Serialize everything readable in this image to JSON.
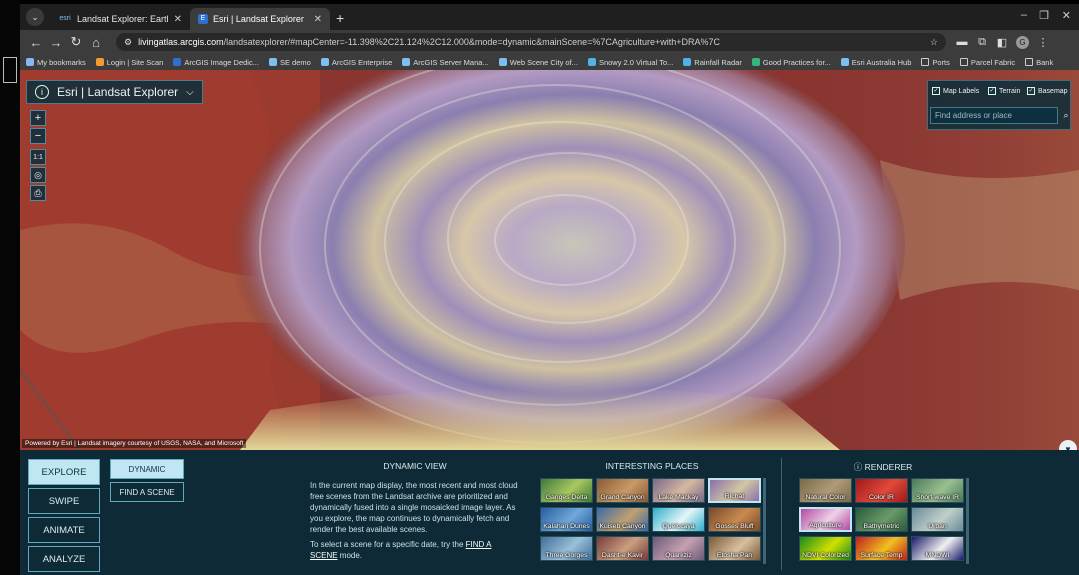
{
  "browser": {
    "tabs": [
      {
        "icon_text": "esri",
        "title": "Landsat Explorer: Earth Science",
        "active": false
      },
      {
        "icon_text": "E",
        "title": "Esri | Landsat Explorer",
        "active": true
      }
    ],
    "new_tab": "+",
    "window_controls": {
      "minimize": "–",
      "maximize": "❐",
      "close": "✕"
    },
    "url_host": "livingatlas.arcgis.com",
    "url_path": "/landsatexplorer/#mapCenter=-11.398%2C21.124%2C12.000&mode=dynamic&mainScene=%7CAgriculture+with+DRA%7C",
    "profile_initial": "G",
    "bookmarks": [
      {
        "label": "My bookmarks",
        "color": "#8ab4f8"
      },
      {
        "label": "Login | Site Scan",
        "color": "#f29b2e"
      },
      {
        "label": "ArcGIS Image Dedic...",
        "color": "#2f6fd0"
      },
      {
        "label": "SE demo",
        "color": "#7cc0f0"
      },
      {
        "label": "ArcGIS Enterprise",
        "color": "#7cc0f0"
      },
      {
        "label": "ArcGIS Server Mana...",
        "color": "#7cc0f0"
      },
      {
        "label": "Web Scene City of...",
        "color": "#7cc0f0"
      },
      {
        "label": "Snowy 2.0 Virtual To...",
        "color": "#4fb3e8"
      },
      {
        "label": "Rainfall Radar",
        "color": "#4fb3e8"
      },
      {
        "label": "Good Practices for...",
        "color": "#36b37e"
      },
      {
        "label": "Esri Australia Hub",
        "color": "#7cc0f0"
      },
      {
        "label": "Ports",
        "color": "folder"
      },
      {
        "label": "Parcel Fabric",
        "color": "folder"
      },
      {
        "label": "Bank",
        "color": "folder"
      }
    ]
  },
  "app": {
    "title": "Esri | Landsat Explorer",
    "zoom_in": "+",
    "zoom_out": "−",
    "scale_label": "1:1",
    "layer_toggles": [
      {
        "label": "Map Labels",
        "checked": true
      },
      {
        "label": "Terrain",
        "checked": true
      },
      {
        "label": "Basemap",
        "checked": true
      }
    ],
    "search_placeholder": "Find address or place",
    "attribution": "Powered by Esri | Landsat imagery courtesy of USGS, NASA, and Microsoft"
  },
  "panel": {
    "modes": [
      "EXPLORE",
      "SWIPE",
      "ANIMATE",
      "ANALYZE"
    ],
    "active_mode": "EXPLORE",
    "submodes": [
      "DYNAMIC",
      "FIND A SCENE"
    ],
    "active_submode": "DYNAMIC",
    "dynamic_view": {
      "heading": "DYNAMIC VIEW",
      "paragraph": "In the current map display, the most recent and most cloud free scenes from the Landsat archive are prioritized and dynamically fused into a single mosaicked image layer. As you explore, the map continues to dynamically fetch and render the best available scenes.",
      "hint_before": "To select a scene for a specific date, try the ",
      "hint_link": "FIND A SCENE",
      "hint_after": " mode."
    },
    "interesting_places": {
      "heading": "INTERESTING PLACES",
      "selected": "Richat",
      "items": [
        {
          "label": "Ganges Delta",
          "c1": "#3f7a3a",
          "c2": "#a8c860"
        },
        {
          "label": "Grand Canyon",
          "c1": "#8a5a36",
          "c2": "#c79a66"
        },
        {
          "label": "Lake Mackay",
          "c1": "#7a6a8a",
          "c2": "#d6b8a0"
        },
        {
          "label": "Richat",
          "c1": "#8a6fa8",
          "c2": "#d3c6a4"
        },
        {
          "label": "Kalahari Dunes",
          "c1": "#2a5da0",
          "c2": "#6fa8d8"
        },
        {
          "label": "Kuiseb Canyon",
          "c1": "#3b6aa8",
          "c2": "#c0a070"
        },
        {
          "label": "Quelccaya",
          "c1": "#2ab0c8",
          "c2": "#e6f4f8"
        },
        {
          "label": "Gosses Bluff",
          "c1": "#7a4a2a",
          "c2": "#c98a50"
        },
        {
          "label": "Three Gorges",
          "c1": "#3f6e9a",
          "c2": "#9ac0d8"
        },
        {
          "label": "Dasht-e Kavir",
          "c1": "#7a3a3a",
          "c2": "#c9a080"
        },
        {
          "label": "Quarkziz",
          "c1": "#6a5a78",
          "c2": "#c6a0b0"
        },
        {
          "label": "Etosha Pan",
          "c1": "#7a5a3a",
          "c2": "#d6c0a0"
        }
      ]
    },
    "renderer": {
      "heading": "RENDERER",
      "selected": "Agriculture",
      "items": [
        {
          "label": "Natural Color",
          "c1": "#7a6a4a",
          "c2": "#b09a78"
        },
        {
          "label": "Color IR",
          "c1": "#a01818",
          "c2": "#e04a3a"
        },
        {
          "label": "Short-wave IR",
          "c1": "#4a7a5a",
          "c2": "#9ac090"
        },
        {
          "label": "Agriculture",
          "c1": "#b04aa0",
          "c2": "#f0d0e8"
        },
        {
          "label": "Bathymetric",
          "c1": "#2a5a3a",
          "c2": "#6a9a6a"
        },
        {
          "label": "Urban",
          "c1": "#6a8a9a",
          "c2": "#c0d0c8"
        },
        {
          "label": "NDVI Colorized",
          "c1": "#1a8a1a",
          "c2": "#d0e000"
        },
        {
          "label": "Surface Temp",
          "c1": "#c02020",
          "c2": "#f0c020"
        },
        {
          "label": "MNDWI",
          "c1": "#1a1a6a",
          "c2": "#f0f0f0"
        }
      ]
    }
  }
}
